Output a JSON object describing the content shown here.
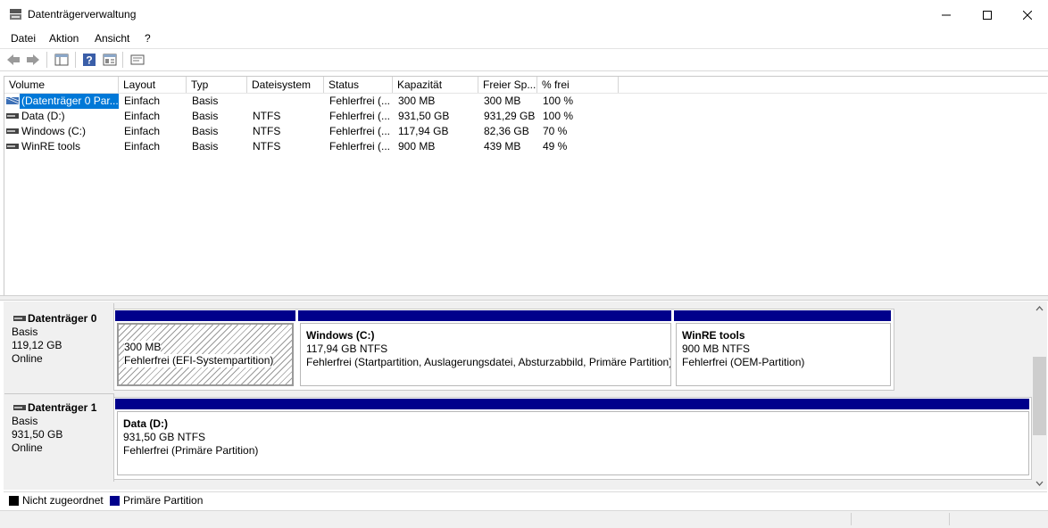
{
  "window": {
    "title": "Datenträgerverwaltung"
  },
  "menu": [
    "Datei",
    "Aktion",
    "Ansicht",
    "?"
  ],
  "list": {
    "columns": [
      "Volume",
      "Layout",
      "Typ",
      "Dateisystem",
      "Status",
      "Kapazität",
      "Freier Sp...",
      "% frei"
    ],
    "rows": [
      [
        "(Datenträger 0 Par...",
        "Einfach",
        "Basis",
        "",
        "Fehlerfrei (...",
        "300 MB",
        "300 MB",
        "100 %"
      ],
      [
        "Data (D:)",
        "Einfach",
        "Basis",
        "NTFS",
        "Fehlerfrei (...",
        "931,50 GB",
        "931,29 GB",
        "100 %"
      ],
      [
        "Windows (C:)",
        "Einfach",
        "Basis",
        "NTFS",
        "Fehlerfrei (...",
        "117,94 GB",
        "82,36 GB",
        "70 %"
      ],
      [
        "WinRE tools",
        "Einfach",
        "Basis",
        "NTFS",
        "Fehlerfrei (...",
        "900 MB",
        "439 MB",
        "49 %"
      ]
    ]
  },
  "disks": [
    {
      "name": "Datenträger 0",
      "type": "Basis",
      "size": "119,12 GB",
      "state": "Online",
      "partitions": [
        {
          "title": "",
          "size": "300 MB",
          "status": "Fehlerfrei (EFI-Systempartition)"
        },
        {
          "title": "Windows  (C:)",
          "size": "117,94 GB NTFS",
          "status": "Fehlerfrei (Startpartition, Auslagerungsdatei, Absturzabbild, Primäre Partition)"
        },
        {
          "title": "WinRE tools",
          "size": "900 MB NTFS",
          "status": "Fehlerfrei (OEM-Partition)"
        }
      ]
    },
    {
      "name": "Datenträger 1",
      "type": "Basis",
      "size": "931,50 GB",
      "state": "Online",
      "partitions": [
        {
          "title": "Data  (D:)",
          "size": "931,50 GB NTFS",
          "status": "Fehlerfrei (Primäre Partition)"
        }
      ]
    }
  ],
  "legend": {
    "unallocated": {
      "label": "Nicht zugeordnet",
      "color": "#000000"
    },
    "primary": {
      "label": "Primäre Partition",
      "color": "#00008b"
    }
  },
  "icons": [
    "disk-management-icon",
    "back-arrow-icon",
    "forward-arrow-icon",
    "console-tree-icon",
    "help-icon",
    "properties-icon",
    "settings-icon",
    "volume-icon",
    "disk-icon"
  ]
}
